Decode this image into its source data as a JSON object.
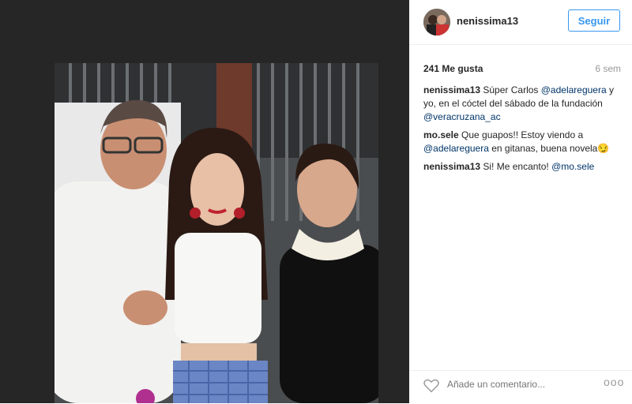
{
  "post": {
    "username": "nenissima13",
    "follow_label": "Seguir",
    "likes": "241 Me gusta",
    "time_ago": "6 sem",
    "add_comment_placeholder": "Añade un comentario...",
    "more_glyph": "ooo",
    "comments": [
      {
        "user": "nenissima13",
        "segments": [
          {
            "type": "text",
            "text": " Súper Carlos "
          },
          {
            "type": "mention",
            "text": "@adelareguera"
          },
          {
            "type": "text",
            "text": " y yo, en el cóctel del sábado de la fundación "
          },
          {
            "type": "mention",
            "text": "@veracruzana_ac"
          }
        ]
      },
      {
        "user": "mo.sele",
        "segments": [
          {
            "type": "text",
            "text": " Que guapos!! Estoy viendo a "
          },
          {
            "type": "mention",
            "text": "@adelareguera"
          },
          {
            "type": "text",
            "text": " en gitanas, buena novela😏"
          }
        ]
      },
      {
        "user": "nenissima13",
        "segments": [
          {
            "type": "text",
            "text": " Si! Me encanto! "
          },
          {
            "type": "mention",
            "text": "@mo.sele"
          }
        ]
      }
    ]
  },
  "icons": {
    "like": "heart-outline-icon",
    "more": "more-options-icon"
  },
  "colors": {
    "accent": "#3897f0",
    "mention": "#003569",
    "muted": "#999999",
    "panel_bg": "#262626"
  }
}
